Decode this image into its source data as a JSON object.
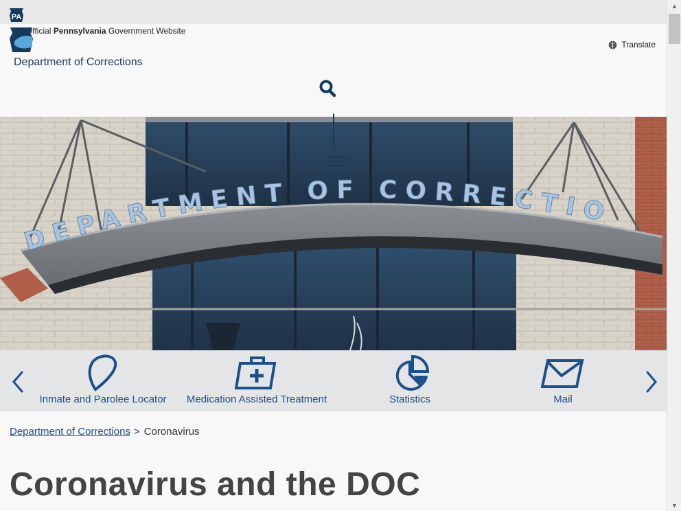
{
  "header": {
    "pa_badge": "PA",
    "official_prefix": "Official",
    "official_state": "Pennsylvania",
    "official_suffix": "Government Website",
    "translate_label": "Translate",
    "agency_name": "Department of Corrections",
    "menu_label": "Menu"
  },
  "hero": {
    "sign_text": "DEPARTMENT OF CORRECTIO"
  },
  "quick_links": [
    {
      "label": "Inmate and Parolee Locator",
      "icon": "location-pin-icon"
    },
    {
      "label": "Medication Assisted Treatment",
      "icon": "medical-kit-icon"
    },
    {
      "label": "Statistics",
      "icon": "pie-chart-icon"
    },
    {
      "label": "Mail",
      "icon": "envelope-icon"
    }
  ],
  "breadcrumb": {
    "parent": "Department of Corrections",
    "separator": ">",
    "current": "Coronavirus"
  },
  "page_title": "Coronavirus and the DOC",
  "colors": {
    "brand_navy": "#143b5c",
    "link_blue": "#1d4f8a",
    "quicklinks_bg": "#e4e5e7"
  }
}
